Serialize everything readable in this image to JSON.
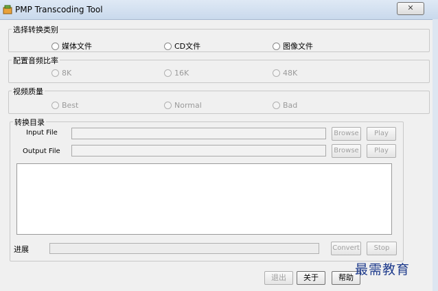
{
  "window": {
    "title": "PMP Transcoding Tool",
    "close_label": "✕"
  },
  "category": {
    "label": "选择转换类别",
    "options": [
      "媒体文件",
      "CD文件",
      "图像文件"
    ]
  },
  "audio": {
    "label": "配置音频比率",
    "options": [
      "8K",
      "16K",
      "48K"
    ]
  },
  "video": {
    "label": "视频质量",
    "options": [
      "Best",
      "Normal",
      "Bad"
    ]
  },
  "convert": {
    "label": "转换目录",
    "input_label": "Input File",
    "output_label": "Output File",
    "input_value": "",
    "output_value": "",
    "browse_label": "Browse",
    "play_label": "Play"
  },
  "progress": {
    "label": "进展",
    "convert_label": "Convert",
    "stop_label": "Stop"
  },
  "footer": {
    "exit_label": "退出",
    "about_label": "关于",
    "help_label": "帮助"
  },
  "watermark": "最需教育"
}
